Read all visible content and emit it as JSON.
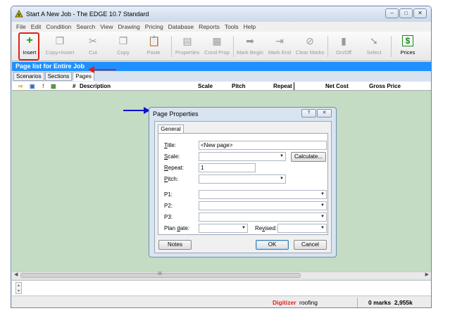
{
  "window": {
    "title": "Start A New Job - The EDGE 10.7 Standard",
    "caption_buttons": [
      "–",
      "□",
      "✕"
    ]
  },
  "menu": [
    "File",
    "Edit",
    "Condition",
    "Search",
    "View",
    "Drawing",
    "Pricing",
    "Database",
    "Reports",
    "Tools",
    "Help"
  ],
  "toolbar": {
    "insert": "Insert",
    "copy_insert": "Copy+Insert",
    "cut": "Cut",
    "copy": "Copy",
    "paste": "Paste",
    "properties": "Properties",
    "cond_prop": "Cond Prop",
    "mark_begin": "Mark Begin",
    "mark_end": "Mark End",
    "clear_marks": "Clear Marks",
    "on_off": "On/Off",
    "select": "Select",
    "prices": "Prices"
  },
  "section_header": "Page list for Entire Job",
  "tabs": [
    "Scenarios",
    "Sections",
    "Pages"
  ],
  "grid_columns": {
    "number": "#",
    "description": "Description",
    "scale": "Scale",
    "pitch": "Pitch",
    "repeat": "Repeat",
    "net_cost": "Net Cost",
    "gross_price": "Gross Price"
  },
  "hscroll_grip": "III",
  "statusbar": {
    "digitizer": "Digitizer",
    "job_type": "roofing",
    "marks": "0 marks",
    "size": "2,955k"
  },
  "dialog": {
    "title": "Page Properties",
    "help_button": "?",
    "close_button": "✕",
    "tab": "General",
    "fields": {
      "title_label_u": "T",
      "title_label_rest": "itle:",
      "title_value": "<New page>",
      "scale_label_u": "S",
      "scale_label_rest": "cale:",
      "scale_value": "",
      "calculate_button": "Calculate...",
      "repeat_label_u": "R",
      "repeat_label_rest": "epeat:",
      "repeat_value": "1",
      "pitch_label_u": "P",
      "pitch_label_rest": "itch:",
      "pitch_value": "",
      "p1_label": "P1:",
      "p1_value": "",
      "p2_label": "P2:",
      "p2_value": "",
      "p3_label": "P3:",
      "p3_value": "",
      "plan_date_label_a": "Plan ",
      "plan_date_label_u": "d",
      "plan_date_label_b": "ate:",
      "plan_date_value": "",
      "revised_label_a": "Re",
      "revised_label_u": "v",
      "revised_label_b": "ised:",
      "revised_value": ""
    },
    "notes_button": "Notes",
    "ok_button": "OK",
    "cancel_button": "Cancel"
  },
  "colors": {
    "section_header": "#1e90ff",
    "grid_background": "#c3dcc3",
    "annotation_red": "#e0201a",
    "annotation_blue": "#1010d0"
  }
}
